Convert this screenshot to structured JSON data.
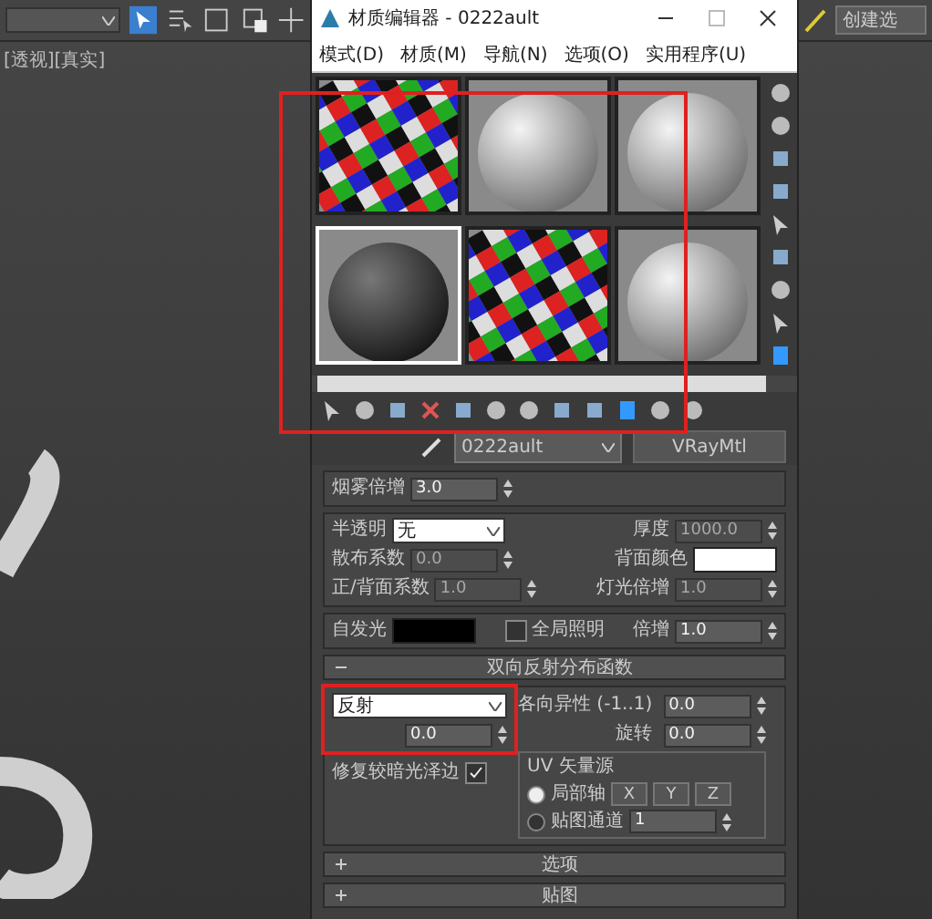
{
  "main_toolbar": {
    "selection_set": "创建选"
  },
  "viewport": {
    "label": "[透视][真实]"
  },
  "window": {
    "title": "材质编辑器 - 0222ault"
  },
  "menu": [
    "模式(D)",
    "材质(M)",
    "导航(N)",
    "选项(O)",
    "实用程序(U)"
  ],
  "sample_slots": [
    {
      "kind": "checker",
      "selected": false
    },
    {
      "kind": "sphere",
      "selected": false
    },
    {
      "kind": "sphere",
      "selected": false
    },
    {
      "kind": "dark-sphere",
      "selected": true
    },
    {
      "kind": "checker",
      "selected": false
    },
    {
      "kind": "sphere",
      "selected": false
    }
  ],
  "material": {
    "name": "0222ault",
    "type": "VRayMtl"
  },
  "groups": [
    [
      [
        {
          "kind": "spinner",
          "label": "烟雾倍增",
          "value": "3.0",
          "disabled": false
        }
      ]
    ],
    [
      [
        {
          "kind": "dropdown",
          "label": "半透明",
          "value": "无"
        },
        {
          "kind": "spinner",
          "label": "厚度",
          "value": "1000.0",
          "disabled": true
        }
      ],
      [
        {
          "kind": "spinner",
          "label": "散布系数",
          "value": "0.0",
          "disabled": true
        },
        {
          "kind": "swatch",
          "label": "背面颜色",
          "color": "#ffffff"
        }
      ],
      [
        {
          "kind": "spinner",
          "label": "正/背面系数",
          "value": "1.0",
          "disabled": true
        },
        {
          "kind": "spinner",
          "label": "灯光倍增",
          "value": "1.0",
          "disabled": true
        }
      ]
    ],
    [
      [
        {
          "kind": "swatch",
          "label": "自发光",
          "color": "#000000"
        },
        {
          "kind": "checkbox",
          "label": "全局照明",
          "checked": false
        },
        {
          "kind": "spinner",
          "label": "倍增",
          "value": "1.0",
          "disabled": false
        }
      ]
    ]
  ],
  "brdf": {
    "title": "双向反射分布函数",
    "expanded": true,
    "type": "反射",
    "value": "0.0",
    "checkbox": {
      "label": "修复较暗光泽边",
      "checked": true
    },
    "anisotropy": {
      "label": "各向异性 (-1..1)",
      "value": "0.0"
    },
    "rotation": {
      "label": "旋转",
      "value": "0.0"
    },
    "uv": {
      "title": "UV 矢量源",
      "options": [
        {
          "label": "局部轴",
          "selected": true
        },
        {
          "label": "贴图通道",
          "selected": false
        }
      ],
      "axes": [
        "X",
        "Y",
        "Z"
      ],
      "channel": "1"
    }
  },
  "rollouts": [
    {
      "title": "选项",
      "expanded": false
    },
    {
      "title": "贴图",
      "expanded": false
    }
  ]
}
